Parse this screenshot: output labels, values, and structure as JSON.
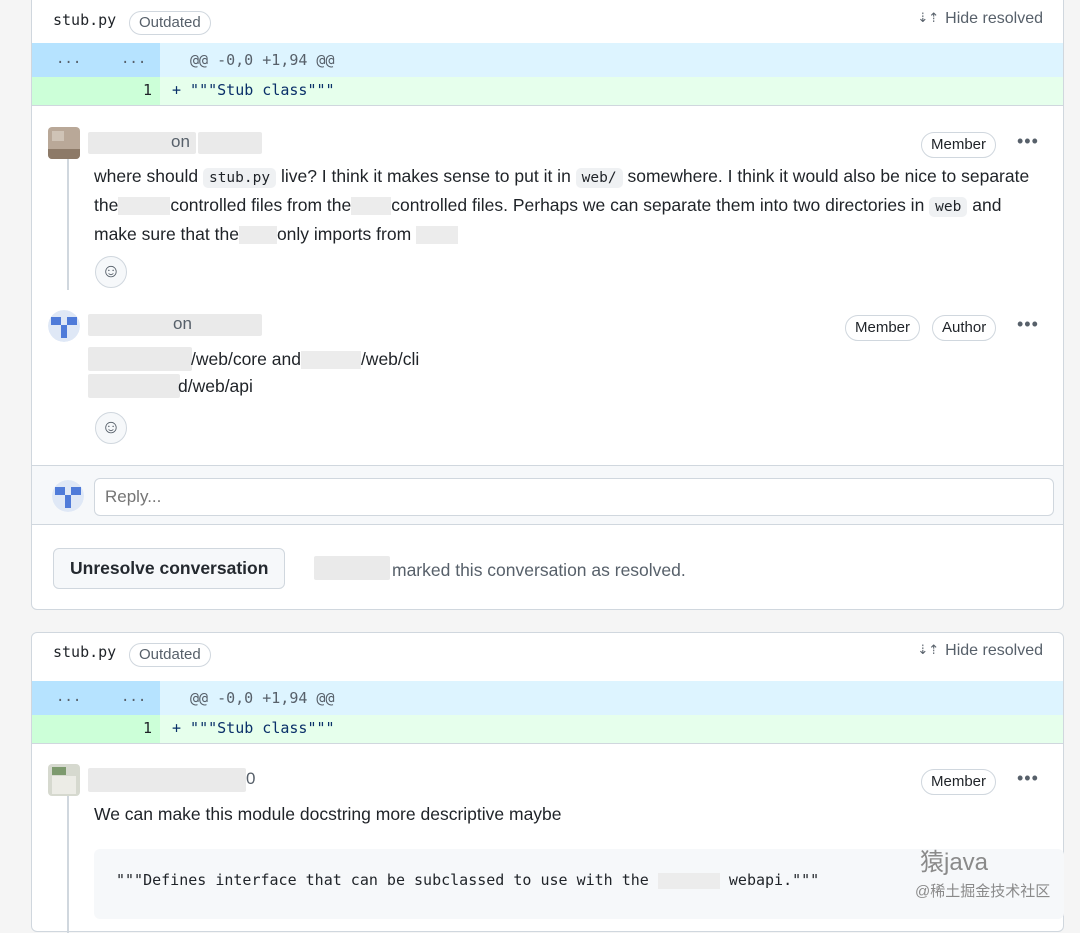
{
  "threads": [
    {
      "file_name": "stub.py",
      "outdated_label": "Outdated",
      "hide_resolved_label": "Hide resolved",
      "hunk_dots_left": "...",
      "hunk_dots_right": "...",
      "hunk_header": "@@ -0,0 +1,94 @@",
      "diff_line_number": "1",
      "diff_line_text": "+ \"\"\"Stub class\"\"\"",
      "comments": [
        {
          "meta_text": "on",
          "role_badges": [
            "Member"
          ],
          "body_parts": {
            "p1": "where should ",
            "c1": "stub.py",
            "p2": " live? I think it makes sense to put it in ",
            "c2": "web/",
            "p3": " somewhere. I think it would also be nice to separate the",
            "p4": "controlled files from the",
            "p5": "controlled files. Perhaps we can separate them into two directories in ",
            "c3": "web",
            "p6": " and make sure that the",
            "p7": "only imports from"
          }
        },
        {
          "meta_text": "on",
          "role_badges": [
            "Member",
            "Author"
          ],
          "line1a": "/web/core and",
          "line1b": "/web/cli",
          "line2": "d/web/api"
        }
      ],
      "reply_placeholder": "Reply...",
      "unresolve_label": "Unresolve conversation",
      "resolved_text": "marked this conversation as resolved."
    },
    {
      "file_name": "stub.py",
      "outdated_label": "Outdated",
      "hide_resolved_label": "Hide resolved",
      "hunk_dots_left": "...",
      "hunk_dots_right": "...",
      "hunk_header": "@@ -0,0 +1,94 @@",
      "diff_line_number": "1",
      "diff_line_text": "+ \"\"\"Stub class\"\"\"",
      "comments": [
        {
          "meta_text": "0",
          "role_badges": [
            "Member"
          ],
          "body": "We can make this module docstring more descriptive maybe",
          "code_a": "\"\"\"Defines interface that can be subclassed to use with the",
          "code_b": "webapi.\"\"\""
        }
      ]
    }
  ],
  "icons": {
    "hide_resolved": "unfold-icon",
    "reaction": "smiley-icon",
    "menu": "kebab-horizontal-icon"
  },
  "watermark": {
    "line1": "猿java",
    "line2": "@稀土掘金技术社区"
  },
  "colors": {
    "hunk_bg": "#ddf4ff",
    "hunk_gutter": "#b6e3ff",
    "addition_bg": "#e6ffec",
    "addition_gutter": "#ccffd8",
    "border": "#d0d7de"
  }
}
